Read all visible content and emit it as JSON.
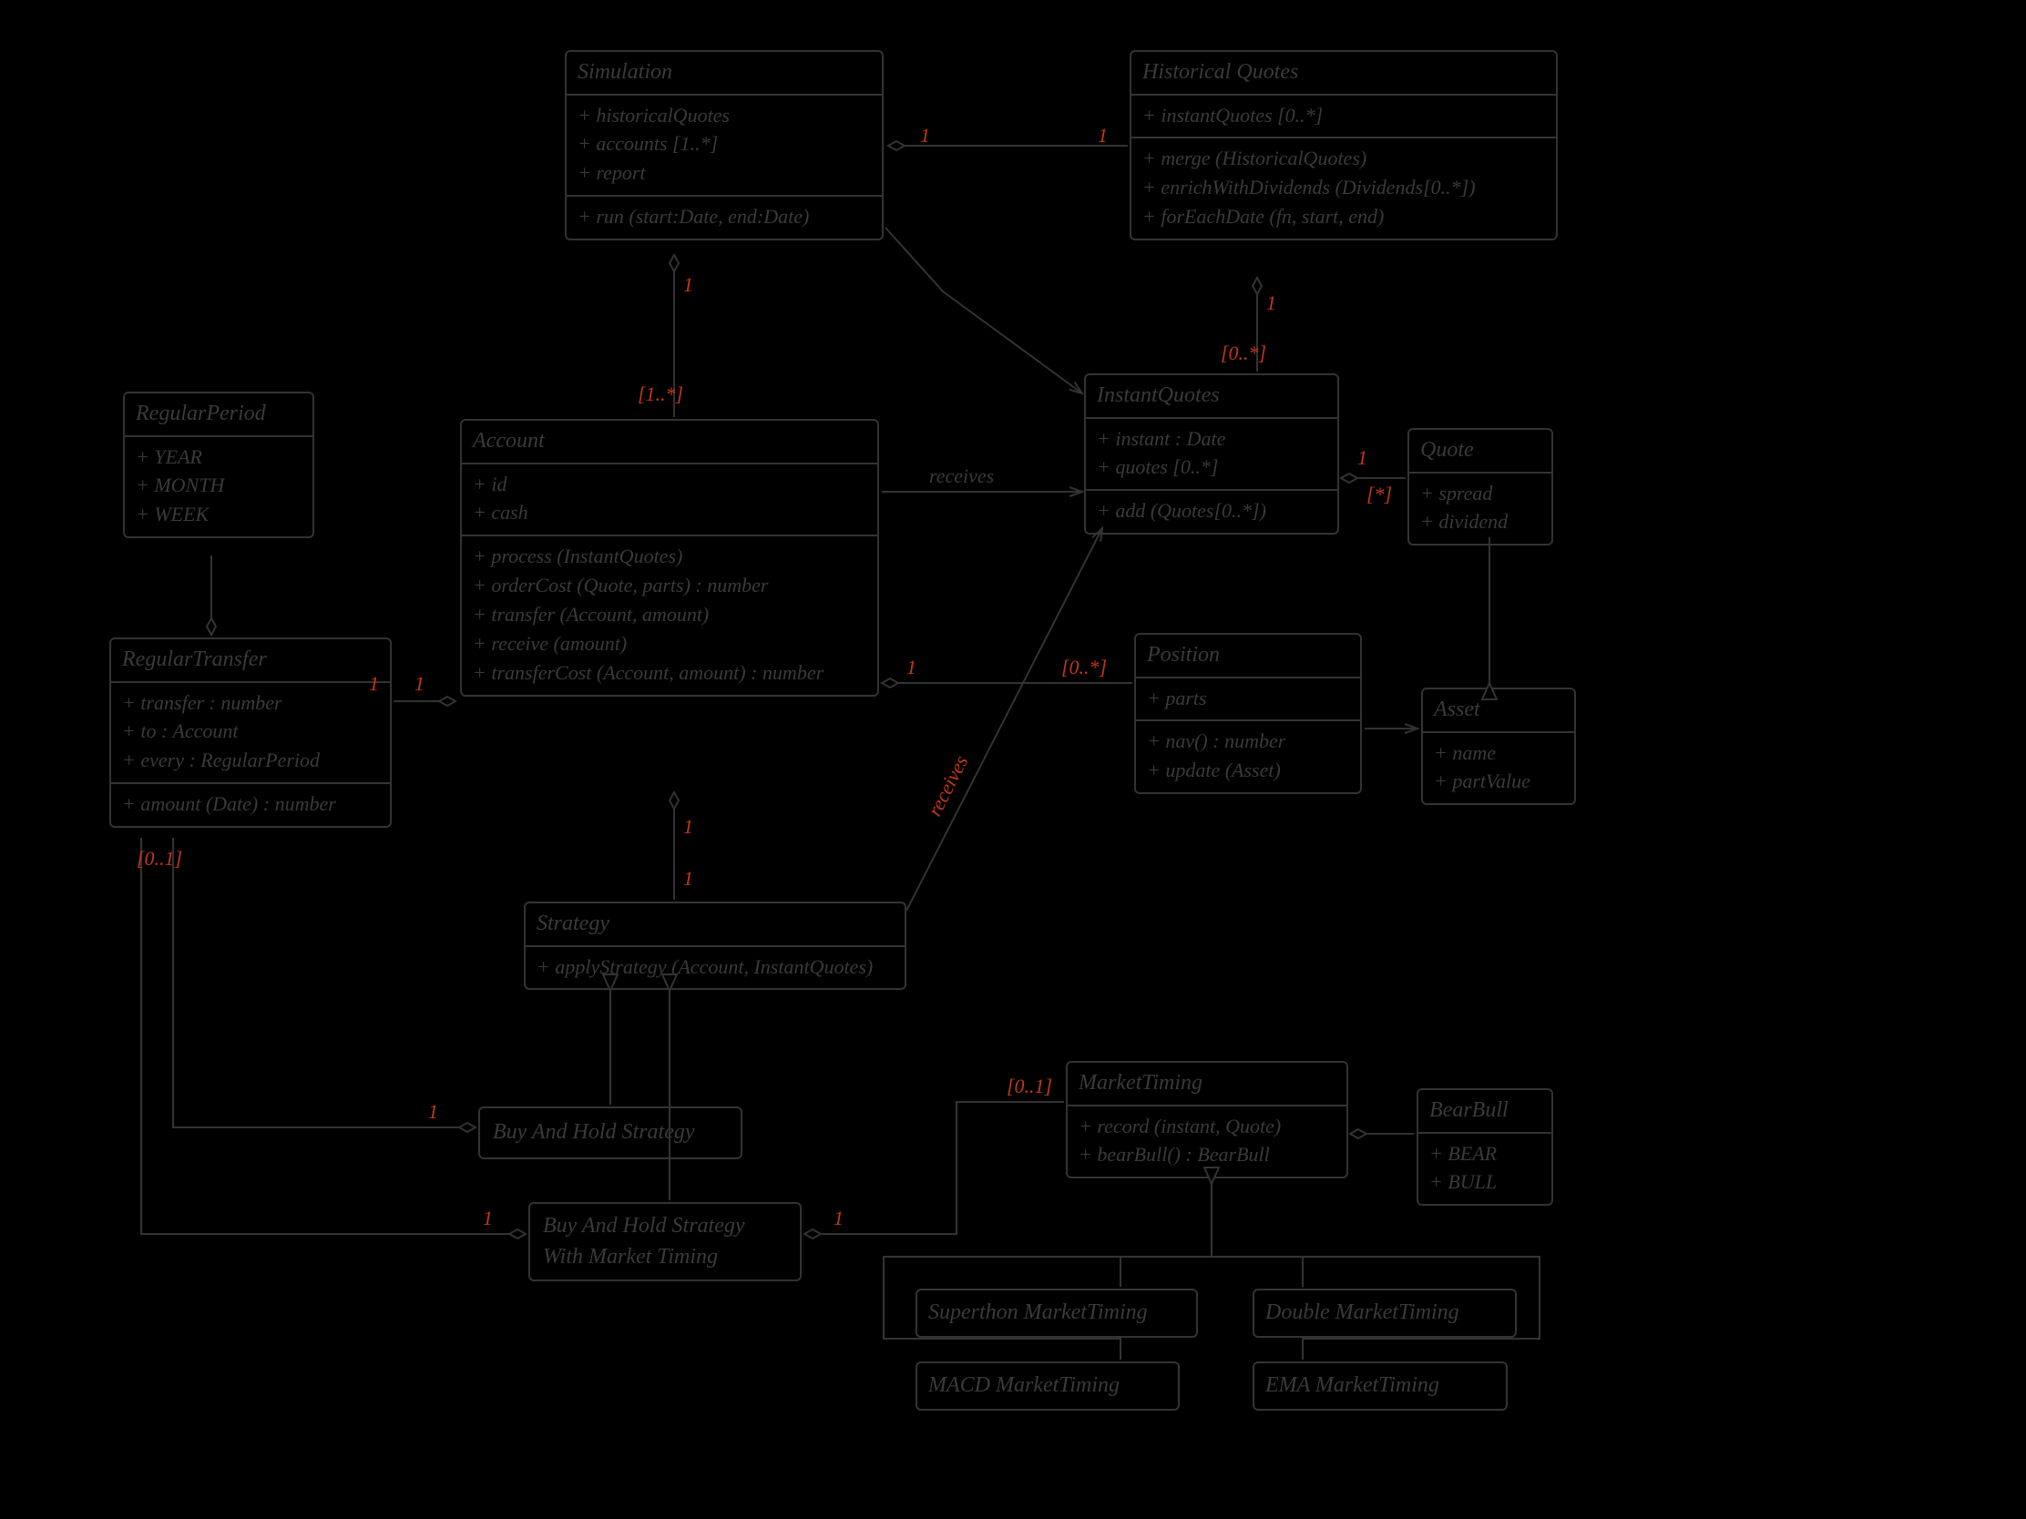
{
  "styleNote": "hand-drawn",
  "classes": {
    "Simulation": {
      "title": "Simulation",
      "attrs": "+ historicalQuotes\n+ accounts [1..*]\n+ report",
      "ops": "+ run (start:Date, end:Date)"
    },
    "HistoricalQuotes": {
      "title": "Historical Quotes",
      "attrs": "+ instantQuotes [0..*]",
      "ops": "+ merge (HistoricalQuotes)\n+ enrichWithDividends (Dividends[0..*])\n+ forEachDate (fn, start, end)"
    },
    "InstantQuotes": {
      "title": "InstantQuotes",
      "attrs": "+ instant : Date\n+ quotes [0..*]",
      "ops": "+ add (Quotes[0..*])"
    },
    "Quote": {
      "title": "Quote",
      "attrs": "+ spread\n+ dividend"
    },
    "Asset": {
      "title": "Asset",
      "attrs": "+ name\n+ partValue"
    },
    "Position": {
      "title": "Position",
      "attrs": "+ parts",
      "ops": "+ nav() : number\n+ update (Asset)"
    },
    "Account": {
      "title": "Account",
      "attrs": "+ id\n+ cash",
      "ops": "+ process (InstantQuotes)\n+ orderCost (Quote, parts) : number\n+ transfer (Account, amount)\n+ receive (amount)\n+ transferCost (Account, amount) : number"
    },
    "RegularPeriod": {
      "title": "RegularPeriod",
      "attrs": "+ YEAR\n+ MONTH\n+ WEEK"
    },
    "RegularTransfer": {
      "title": "RegularTransfer",
      "attrs": "+ transfer : number\n+ to : Account\n+ every : RegularPeriod",
      "ops": "+ amount (Date) : number"
    },
    "Strategy": {
      "title": "Strategy",
      "ops": "+ applyStrategy (Account, InstantQuotes)"
    },
    "BuyAndHoldStrategy": {
      "title": "Buy And Hold Strategy"
    },
    "BuyAndHoldStrategyWithMT": {
      "title": "Buy And Hold Strategy\nWith Market Timing"
    },
    "MarketTiming": {
      "title": "MarketTiming",
      "ops": "+ record (instant, Quote)\n+ bearBull() : BearBull"
    },
    "BearBull": {
      "title": "BearBull",
      "attrs": "+ BEAR\n+ BULL"
    },
    "SuperthonMarketTiming": {
      "title": "Superthon MarketTiming"
    },
    "DoubleMarketTiming": {
      "title": "Double MarketTiming"
    },
    "MACDMarketTiming": {
      "title": "MACD MarketTiming"
    },
    "EMAMarketTiming": {
      "title": "EMA MarketTiming"
    }
  },
  "labels": {
    "one": "1",
    "oneStar": "[1..*]",
    "zeroStar": "[0..*]",
    "zeroOne": "[0..1]",
    "LW": "[*]",
    "receives": "receives"
  }
}
